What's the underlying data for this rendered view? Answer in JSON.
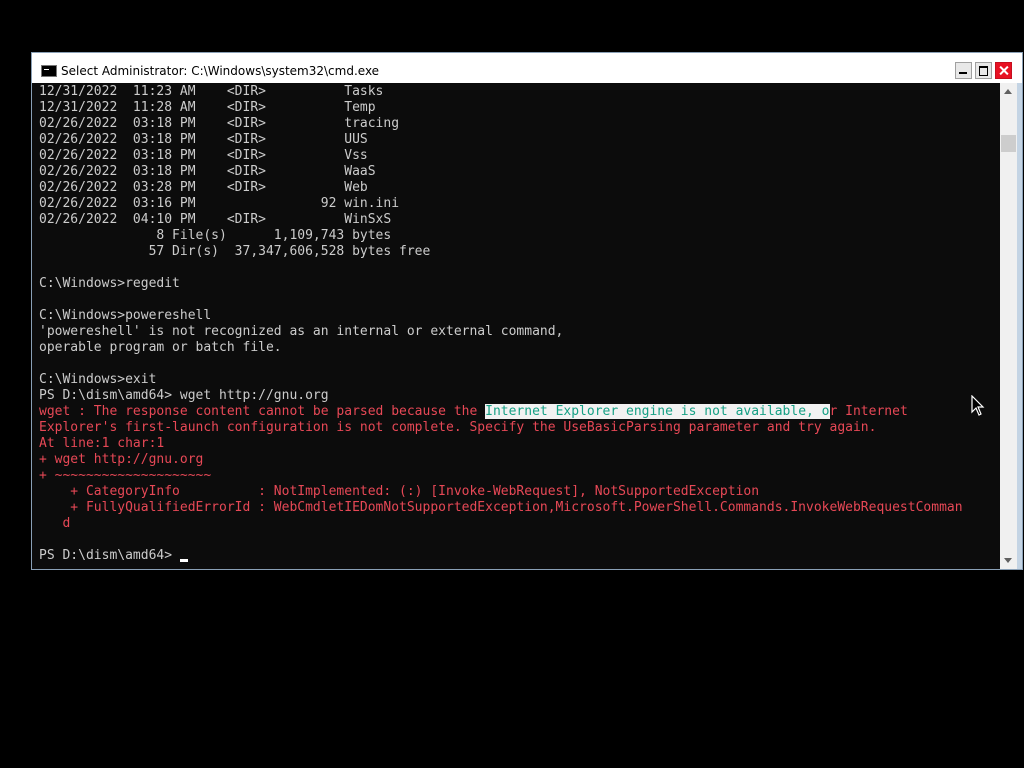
{
  "window": {
    "title": "Select Administrator: C:\\Windows\\system32\\cmd.exe",
    "icon": "cmd-icon"
  },
  "console": {
    "lines": [
      {
        "text": "12/31/2022  11:23 AM    <DIR>          Tasks",
        "style": "normal"
      },
      {
        "text": "12/31/2022  11:28 AM    <DIR>          Temp",
        "style": "normal"
      },
      {
        "text": "02/26/2022  03:18 PM    <DIR>          tracing",
        "style": "normal"
      },
      {
        "text": "02/26/2022  03:18 PM    <DIR>          UUS",
        "style": "normal"
      },
      {
        "text": "02/26/2022  03:18 PM    <DIR>          Vss",
        "style": "normal"
      },
      {
        "text": "02/26/2022  03:18 PM    <DIR>          WaaS",
        "style": "normal"
      },
      {
        "text": "02/26/2022  03:28 PM    <DIR>          Web",
        "style": "normal"
      },
      {
        "text": "02/26/2022  03:16 PM                92 win.ini",
        "style": "normal"
      },
      {
        "text": "02/26/2022  04:10 PM    <DIR>          WinSxS",
        "style": "normal"
      },
      {
        "text": "               8 File(s)      1,109,743 bytes",
        "style": "normal"
      },
      {
        "text": "              57 Dir(s)  37,347,606,528 bytes free",
        "style": "normal"
      },
      {
        "text": "",
        "style": "normal"
      },
      {
        "text": "C:\\Windows>regedit",
        "style": "normal"
      },
      {
        "text": "",
        "style": "normal"
      },
      {
        "text": "C:\\Windows>powereshell",
        "style": "normal"
      },
      {
        "text": "'powereshell' is not recognized as an internal or external command,",
        "style": "normal"
      },
      {
        "text": "operable program or batch file.",
        "style": "normal"
      },
      {
        "text": "",
        "style": "normal"
      },
      {
        "text": "C:\\Windows>exit",
        "style": "normal"
      },
      {
        "text": "PS D:\\dism\\amd64> wget http://gnu.org",
        "style": "normal"
      },
      {
        "pre": "wget : The response content cannot be parsed because the ",
        "hl": "Internet Explorer engine is not available, o",
        "post": "r Internet",
        "style": "error-hl"
      },
      {
        "text": "Explorer's first-launch configuration is not complete. Specify the UseBasicParsing parameter and try again.",
        "style": "error"
      },
      {
        "text": "At line:1 char:1",
        "style": "error"
      },
      {
        "text": "+ wget http://gnu.org",
        "style": "error"
      },
      {
        "text": "+ ~~~~~~~~~~~~~~~~~~~~",
        "style": "error"
      },
      {
        "text": "    + CategoryInfo          : NotImplemented: (:) [Invoke-WebRequest], NotSupportedException",
        "style": "error"
      },
      {
        "text": "    + FullyQualifiedErrorId : WebCmdletIEDomNotSupportedException,Microsoft.PowerShell.Commands.InvokeWebRequestComman",
        "style": "error"
      },
      {
        "text": "   d",
        "style": "error"
      },
      {
        "text": "",
        "style": "normal"
      },
      {
        "text": "PS D:\\dism\\amd64> ",
        "style": "prompt"
      }
    ]
  },
  "colors": {
    "text": "#cccccc",
    "error": "#e74856",
    "highlight_bg": "#f2f2f2",
    "highlight_fg": "#16a085",
    "console_bg": "#0c0c0c"
  }
}
